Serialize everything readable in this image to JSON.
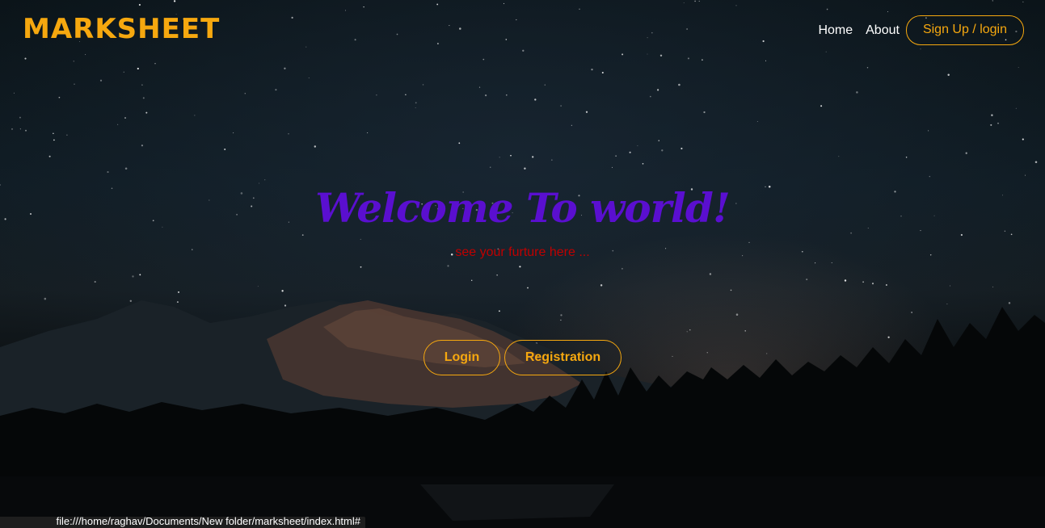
{
  "brand": {
    "logo": "MARKSHEET",
    "accent_color": "#f6a80f"
  },
  "nav": {
    "home": "Home",
    "about": "About",
    "signup": "Sign Up / login"
  },
  "hero": {
    "title": "Welcome To world!",
    "subtitle": "see your furture here ...",
    "title_color": "#5a0fd0",
    "subtitle_color": "#c00000",
    "login_button": "Login",
    "registration_button": "Registration"
  },
  "status_bar": {
    "url": "file:///home/raghav/Documents/New folder/marksheet/index.html#"
  },
  "background": {
    "image": "night-sky-mountains-lake"
  }
}
